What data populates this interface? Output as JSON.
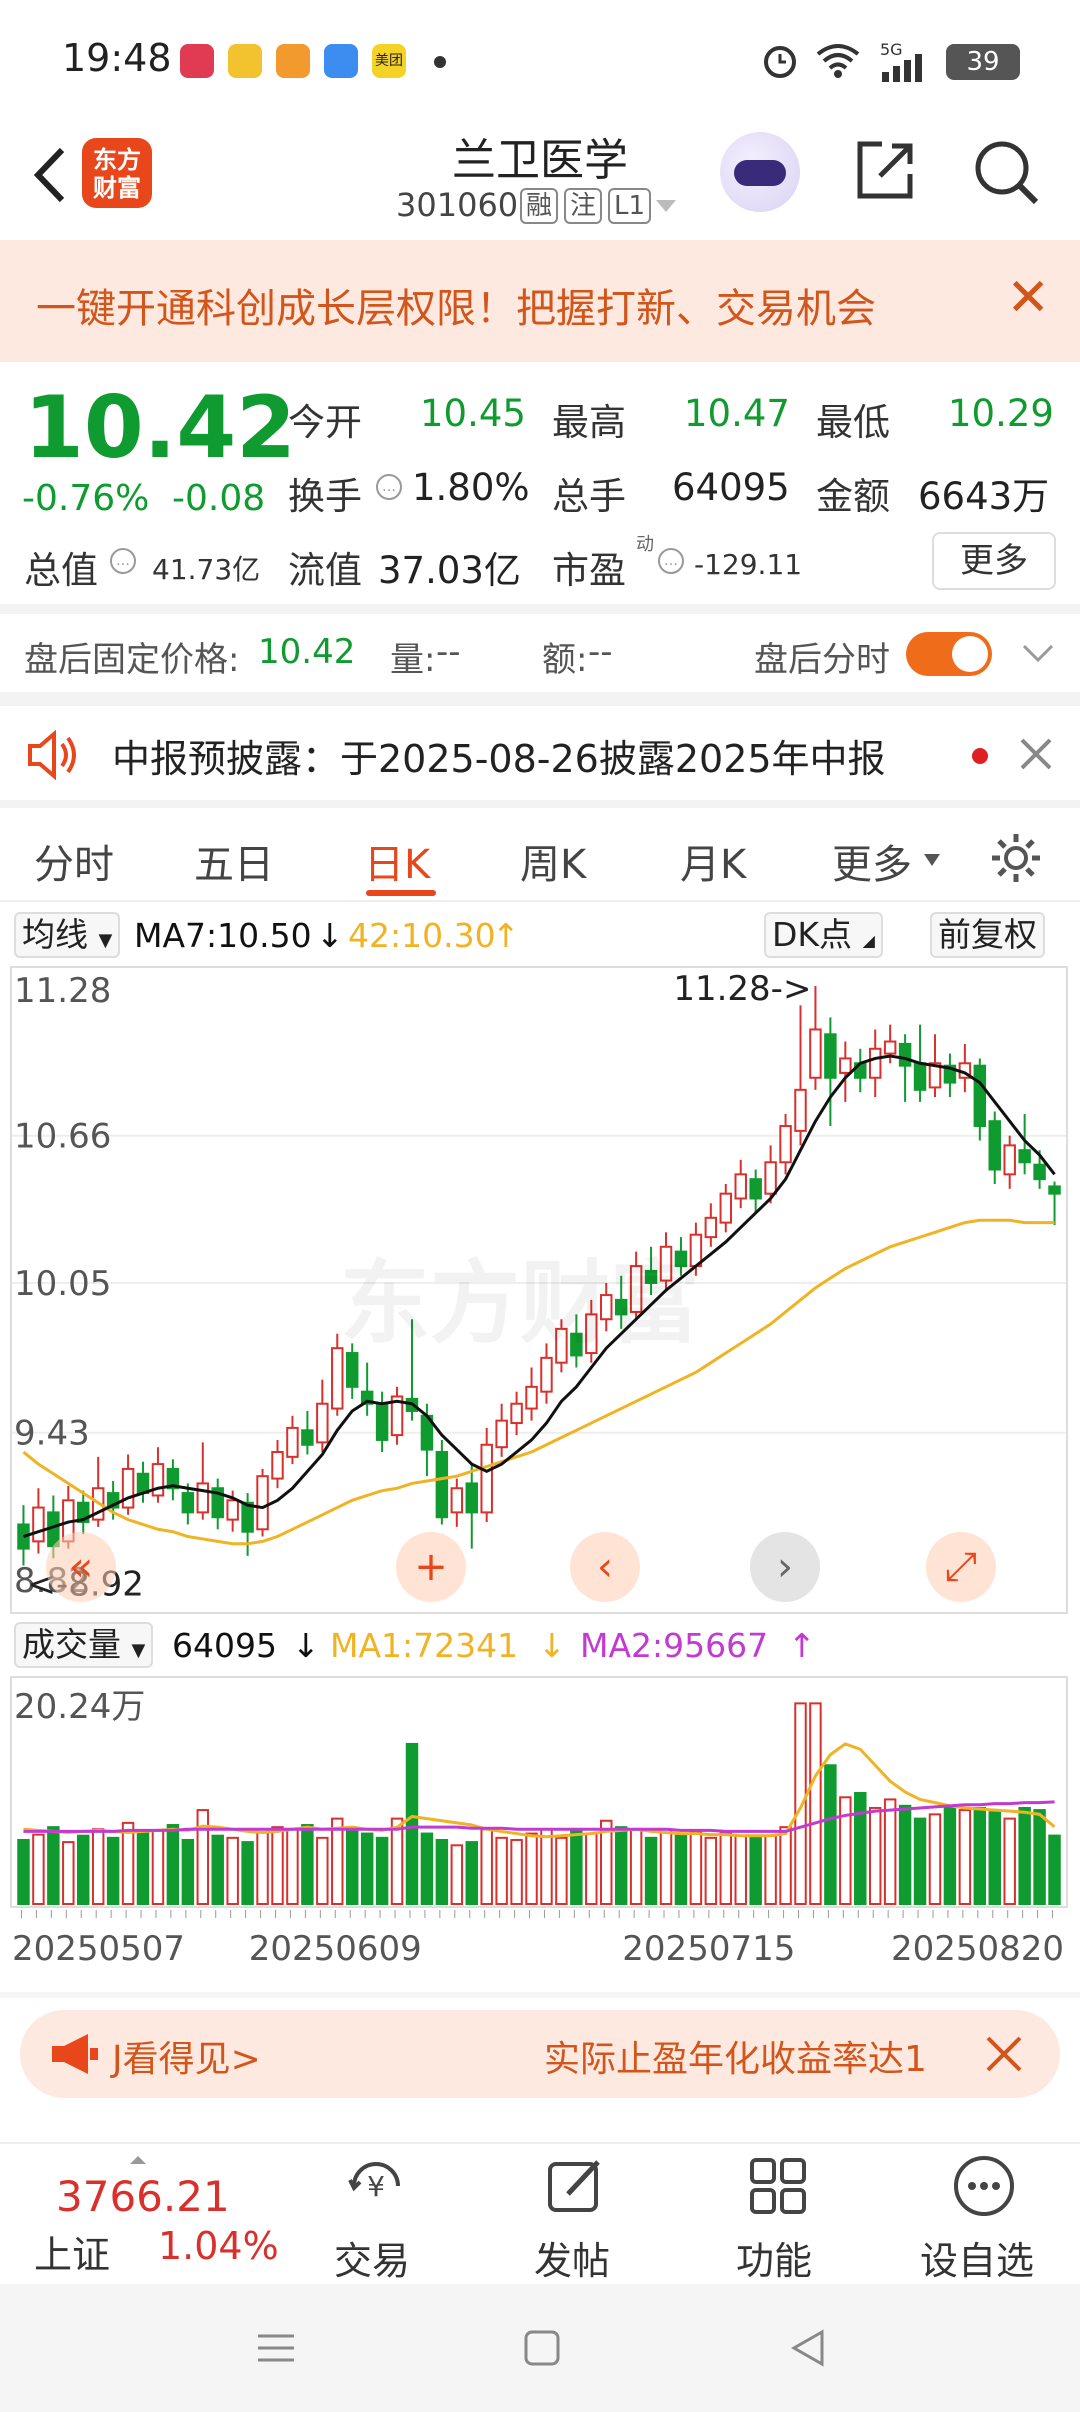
{
  "status_bar": {
    "time": "19:48",
    "battery": "39",
    "network": "5G"
  },
  "header": {
    "title": "兰卫医学",
    "code": "301060",
    "tags": [
      "融",
      "注",
      "L1"
    ],
    "logo_text_line1": "东方",
    "logo_text_line2": "财富"
  },
  "promo": {
    "text": "一键开通科创成长层权限！把握打新、交易机会",
    "close": "✕"
  },
  "quote": {
    "price": "10.42",
    "change_pct": "-0.76%",
    "change": "-0.08",
    "open_label": "今开",
    "open": "10.45",
    "high_label": "最高",
    "high": "10.47",
    "low_label": "最低",
    "low": "10.29",
    "turnover_label": "换手",
    "turnover": "1.80%",
    "volume_label": "总手",
    "volume": "64095",
    "amount_label": "金额",
    "amount": "6643万",
    "mktcap_label": "总值",
    "mktcap": "41.73亿",
    "float_label": "流值",
    "float": "37.03亿",
    "pe_label": "市盈",
    "pe_sup": "动",
    "pe": "-129.11",
    "more": "更多"
  },
  "after_hours": {
    "price_label": "盘后固定价格:",
    "price": "10.42",
    "vol_label": "量:",
    "vol": "--",
    "amt_label": "额:",
    "amt": "--",
    "timeshare": "盘后分时"
  },
  "notice": {
    "text": "中报预披露：于2025-08-26披露2025年中报"
  },
  "tabs": [
    "分时",
    "五日",
    "日K",
    "周K",
    "月K",
    "更多"
  ],
  "chart_controls": {
    "ma_select": "均线",
    "ma7": "MA7:10.50",
    "ma42": "42:10.30",
    "dk": "DK点",
    "adjust": "前复权"
  },
  "volume_controls": {
    "select": "成交量",
    "vol": "64095",
    "ma1": "MA1:72341",
    "ma2": "MA2:95667"
  },
  "colors": {
    "up": "#d9302c",
    "down": "#0f9b2f",
    "accent": "#e8471c",
    "ma7": "#111111",
    "ma42": "#f0b323",
    "vol_ma1": "#f0b323",
    "vol_ma2": "#c23ad1"
  },
  "chart_data": [
    {
      "type": "candlestick",
      "title": "",
      "y_ticks": [
        "11.28",
        "10.66",
        "10.05",
        "9.43",
        "8.82"
      ],
      "ylim": [
        8.82,
        11.28
      ],
      "high_annotation": "11.28->",
      "low_annotation": "<-8.92",
      "x_tick_labels": [
        "20250507",
        "20250609",
        "20250715",
        "20250820"
      ],
      "candles": [
        {
          "o": 9.05,
          "c": 8.95,
          "h": 9.13,
          "l": 8.88
        },
        {
          "o": 8.98,
          "c": 9.12,
          "h": 9.2,
          "l": 8.93
        },
        {
          "o": 9.1,
          "c": 8.96,
          "h": 9.17,
          "l": 8.91
        },
        {
          "o": 8.98,
          "c": 9.15,
          "h": 9.21,
          "l": 8.95
        },
        {
          "o": 9.14,
          "c": 9.06,
          "h": 9.19,
          "l": 9.01
        },
        {
          "o": 9.07,
          "c": 9.2,
          "h": 9.33,
          "l": 9.04
        },
        {
          "o": 9.18,
          "c": 9.12,
          "h": 9.23,
          "l": 9.07
        },
        {
          "o": 9.12,
          "c": 9.28,
          "h": 9.34,
          "l": 9.09
        },
        {
          "o": 9.26,
          "c": 9.18,
          "h": 9.31,
          "l": 9.14
        },
        {
          "o": 9.17,
          "c": 9.3,
          "h": 9.37,
          "l": 9.14
        },
        {
          "o": 9.28,
          "c": 9.2,
          "h": 9.32,
          "l": 9.15
        },
        {
          "o": 9.18,
          "c": 9.1,
          "h": 9.22,
          "l": 9.05
        },
        {
          "o": 9.1,
          "c": 9.22,
          "h": 9.39,
          "l": 9.07
        },
        {
          "o": 9.2,
          "c": 9.08,
          "h": 9.24,
          "l": 9.03
        },
        {
          "o": 9.07,
          "c": 9.15,
          "h": 9.19,
          "l": 9.02
        },
        {
          "o": 9.14,
          "c": 9.02,
          "h": 9.18,
          "l": 8.92
        },
        {
          "o": 9.03,
          "c": 9.25,
          "h": 9.28,
          "l": 9.0
        },
        {
          "o": 9.24,
          "c": 9.35,
          "h": 9.4,
          "l": 9.2
        },
        {
          "o": 9.33,
          "c": 9.45,
          "h": 9.5,
          "l": 9.3
        },
        {
          "o": 9.44,
          "c": 9.38,
          "h": 9.52,
          "l": 9.34
        },
        {
          "o": 9.39,
          "c": 9.55,
          "h": 9.65,
          "l": 9.35
        },
        {
          "o": 9.53,
          "c": 9.78,
          "h": 9.84,
          "l": 9.5
        },
        {
          "o": 9.76,
          "c": 9.62,
          "h": 9.8,
          "l": 9.57
        },
        {
          "o": 9.6,
          "c": 9.55,
          "h": 9.72,
          "l": 9.5
        },
        {
          "o": 9.55,
          "c": 9.4,
          "h": 9.6,
          "l": 9.35
        },
        {
          "o": 9.42,
          "c": 9.58,
          "h": 9.62,
          "l": 9.38
        },
        {
          "o": 9.57,
          "c": 9.52,
          "h": 9.9,
          "l": 9.48
        },
        {
          "o": 9.5,
          "c": 9.36,
          "h": 9.55,
          "l": 9.25
        },
        {
          "o": 9.35,
          "c": 9.08,
          "h": 9.4,
          "l": 9.05
        },
        {
          "o": 9.1,
          "c": 9.2,
          "h": 9.24,
          "l": 9.04
        },
        {
          "o": 9.22,
          "c": 9.1,
          "h": 9.3,
          "l": 8.95
        },
        {
          "o": 9.1,
          "c": 9.38,
          "h": 9.45,
          "l": 9.06
        },
        {
          "o": 9.37,
          "c": 9.48,
          "h": 9.55,
          "l": 9.33
        },
        {
          "o": 9.47,
          "c": 9.55,
          "h": 9.6,
          "l": 9.42
        },
        {
          "o": 9.53,
          "c": 9.62,
          "h": 9.7,
          "l": 9.48
        },
        {
          "o": 9.6,
          "c": 9.74,
          "h": 9.8,
          "l": 9.55
        },
        {
          "o": 9.72,
          "c": 9.86,
          "h": 9.9,
          "l": 9.68
        },
        {
          "o": 9.84,
          "c": 9.75,
          "h": 9.92,
          "l": 9.7
        },
        {
          "o": 9.76,
          "c": 9.92,
          "h": 9.98,
          "l": 9.72
        },
        {
          "o": 9.9,
          "c": 10.0,
          "h": 10.05,
          "l": 9.85
        },
        {
          "o": 9.98,
          "c": 9.92,
          "h": 10.08,
          "l": 9.86
        },
        {
          "o": 9.93,
          "c": 10.12,
          "h": 10.18,
          "l": 9.9
        },
        {
          "o": 10.1,
          "c": 10.05,
          "h": 10.2,
          "l": 10.0
        },
        {
          "o": 10.06,
          "c": 10.2,
          "h": 10.26,
          "l": 10.02
        },
        {
          "o": 10.18,
          "c": 10.12,
          "h": 10.24,
          "l": 10.08
        },
        {
          "o": 10.12,
          "c": 10.25,
          "h": 10.3,
          "l": 10.08
        },
        {
          "o": 10.24,
          "c": 10.32,
          "h": 10.38,
          "l": 10.2
        },
        {
          "o": 10.3,
          "c": 10.42,
          "h": 10.46,
          "l": 10.26
        },
        {
          "o": 10.4,
          "c": 10.5,
          "h": 10.56,
          "l": 10.36
        },
        {
          "o": 10.48,
          "c": 10.4,
          "h": 10.52,
          "l": 10.34
        },
        {
          "o": 10.42,
          "c": 10.55,
          "h": 10.62,
          "l": 10.38
        },
        {
          "o": 10.55,
          "c": 10.7,
          "h": 10.75,
          "l": 10.5
        },
        {
          "o": 10.68,
          "c": 10.85,
          "h": 11.2,
          "l": 10.62
        },
        {
          "o": 10.9,
          "c": 11.1,
          "h": 11.28,
          "l": 10.85
        },
        {
          "o": 11.08,
          "c": 10.9,
          "h": 11.15,
          "l": 10.7
        },
        {
          "o": 10.92,
          "c": 10.98,
          "h": 11.05,
          "l": 10.8
        },
        {
          "o": 10.96,
          "c": 10.9,
          "h": 11.02,
          "l": 10.84
        },
        {
          "o": 10.9,
          "c": 11.02,
          "h": 11.1,
          "l": 10.82
        },
        {
          "o": 11.0,
          "c": 11.05,
          "h": 11.12,
          "l": 10.96
        },
        {
          "o": 11.04,
          "c": 10.95,
          "h": 11.08,
          "l": 10.8
        },
        {
          "o": 10.96,
          "c": 10.85,
          "h": 11.12,
          "l": 10.8
        },
        {
          "o": 10.86,
          "c": 10.96,
          "h": 11.08,
          "l": 10.82
        },
        {
          "o": 10.95,
          "c": 10.88,
          "h": 11.0,
          "l": 10.82
        },
        {
          "o": 10.9,
          "c": 10.96,
          "h": 11.04,
          "l": 10.84
        },
        {
          "o": 10.95,
          "c": 10.7,
          "h": 10.98,
          "l": 10.64
        },
        {
          "o": 10.72,
          "c": 10.52,
          "h": 10.76,
          "l": 10.46
        },
        {
          "o": 10.5,
          "c": 10.62,
          "h": 10.66,
          "l": 10.44
        },
        {
          "o": 10.6,
          "c": 10.55,
          "h": 10.75,
          "l": 10.5
        },
        {
          "o": 10.54,
          "c": 10.48,
          "h": 10.6,
          "l": 10.44
        },
        {
          "o": 10.45,
          "c": 10.42,
          "h": 10.47,
          "l": 10.29
        }
      ],
      "ma7_line": [
        9.0,
        9.02,
        9.04,
        9.06,
        9.07,
        9.1,
        9.13,
        9.16,
        9.18,
        9.2,
        9.21,
        9.2,
        9.19,
        9.18,
        9.16,
        9.13,
        9.12,
        9.15,
        9.2,
        9.27,
        9.34,
        9.44,
        9.52,
        9.56,
        9.55,
        9.56,
        9.55,
        9.5,
        9.42,
        9.36,
        9.3,
        9.27,
        9.3,
        9.35,
        9.4,
        9.47,
        9.56,
        9.62,
        9.7,
        9.78,
        9.84,
        9.9,
        9.96,
        10.02,
        10.07,
        10.12,
        10.17,
        10.22,
        10.28,
        10.34,
        10.4,
        10.48,
        10.6,
        10.72,
        10.82,
        10.9,
        10.96,
        10.98,
        10.99,
        10.98,
        10.96,
        10.95,
        10.94,
        10.92,
        10.88,
        10.8,
        10.72,
        10.64,
        10.58,
        10.5
      ],
      "ma42_line": [
        9.35,
        9.3,
        9.26,
        9.22,
        9.18,
        9.14,
        9.1,
        9.07,
        9.05,
        9.03,
        9.02,
        9.0,
        8.99,
        8.98,
        8.97,
        8.97,
        8.98,
        9.0,
        9.03,
        9.06,
        9.09,
        9.12,
        9.15,
        9.17,
        9.19,
        9.2,
        9.22,
        9.23,
        9.24,
        9.25,
        9.27,
        9.29,
        9.31,
        9.33,
        9.35,
        9.38,
        9.41,
        9.44,
        9.47,
        9.5,
        9.53,
        9.56,
        9.59,
        9.62,
        9.65,
        9.68,
        9.72,
        9.76,
        9.8,
        9.84,
        9.88,
        9.93,
        9.98,
        10.03,
        10.07,
        10.11,
        10.14,
        10.17,
        10.2,
        10.22,
        10.24,
        10.26,
        10.28,
        10.3,
        10.31,
        10.31,
        10.31,
        10.3,
        10.3,
        10.3
      ]
    },
    {
      "type": "bar",
      "title": "",
      "y_ticks": [
        "20.24万"
      ],
      "ylim": [
        0,
        202400
      ],
      "volumes": [
        60000,
        65000,
        72000,
        58000,
        64000,
        70000,
        62000,
        76000,
        66000,
        69000,
        74000,
        60000,
        88000,
        64000,
        62000,
        58000,
        67000,
        72000,
        70000,
        74000,
        62000,
        80000,
        68000,
        66000,
        62000,
        80000,
        150000,
        66000,
        60000,
        55000,
        58000,
        70000,
        62000,
        60000,
        66000,
        70000,
        62000,
        70000,
        66000,
        78000,
        72000,
        70000,
        62000,
        70000,
        64000,
        68000,
        62000,
        66000,
        64000,
        62000,
        64000,
        72000,
        188000,
        188000,
        130000,
        100000,
        104000,
        90000,
        98000,
        92000,
        80000,
        84000,
        92000,
        88000,
        90000,
        86000,
        80000,
        90000,
        88000,
        64095
      ],
      "ma1_line": [
        70000,
        69000,
        68000,
        67000,
        68000,
        69000,
        68000,
        67000,
        68000,
        69000,
        70000,
        69000,
        73000,
        72000,
        70000,
        68000,
        67000,
        68000,
        70000,
        72000,
        70000,
        71000,
        72000,
        70000,
        69000,
        72000,
        82000,
        80000,
        78000,
        76000,
        74000,
        70000,
        68000,
        66000,
        64000,
        63000,
        64000,
        65000,
        66000,
        68000,
        69000,
        70000,
        68000,
        67000,
        66000,
        66000,
        65000,
        65000,
        64000,
        64000,
        64000,
        66000,
        90000,
        120000,
        140000,
        150000,
        145000,
        130000,
        115000,
        105000,
        98000,
        95000,
        92000,
        90000,
        89000,
        88000,
        87000,
        86000,
        84000,
        72341
      ],
      "ma2_line": [
        68000,
        68000,
        68000,
        68000,
        68000,
        68000,
        68000,
        69000,
        69000,
        69000,
        69000,
        70000,
        70000,
        70000,
        70000,
        70000,
        70000,
        70000,
        70000,
        70000,
        70000,
        70000,
        70000,
        70000,
        70000,
        70000,
        72000,
        72000,
        72000,
        72000,
        71000,
        71000,
        71000,
        70000,
        70000,
        70000,
        70000,
        70000,
        70000,
        70000,
        70000,
        70000,
        70000,
        70000,
        69000,
        69000,
        69000,
        68000,
        68000,
        68000,
        68000,
        68000,
        72000,
        76000,
        80000,
        83000,
        85000,
        87000,
        88000,
        89000,
        90000,
        91000,
        92000,
        93000,
        93000,
        94000,
        94000,
        95000,
        95000,
        95667
      ]
    }
  ],
  "chart_nav": [
    "«",
    "+",
    "‹",
    "›",
    "⤢"
  ],
  "ad": {
    "left_text": "J看得见>",
    "right_text": "实际止盈年化收益率达1"
  },
  "bottom_nav": {
    "index_value": "3766.21",
    "index_name": "上证",
    "index_pct": "1.04%",
    "items": [
      "交易",
      "发帖",
      "功能",
      "设自选"
    ]
  }
}
